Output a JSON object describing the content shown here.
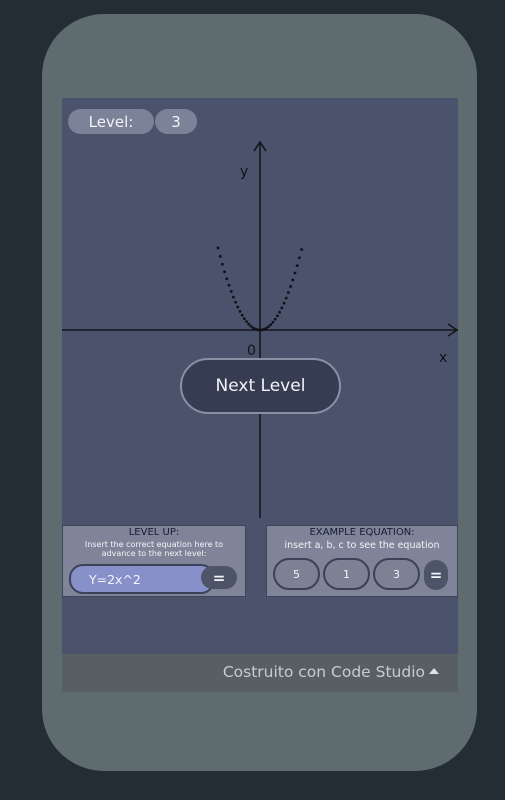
{
  "level": {
    "label": "Level:",
    "value": "3"
  },
  "graph": {
    "x_label": "x",
    "y_label": "y",
    "origin_label": "0",
    "curve_coefficient": 2
  },
  "next_level_button": {
    "label": "Next Level"
  },
  "level_up_panel": {
    "title": "LEVEL UP:",
    "description": "Insert the correct equation here to advance to the next level:",
    "equation_value": "Y=2x^2",
    "equals_label": "="
  },
  "example_panel": {
    "title": "EXAMPLE EQUATION:",
    "description": "insert a, b, c to see the equation",
    "a": "5",
    "b": "1",
    "c": "3",
    "equals_label": "="
  },
  "footer": {
    "text": "Costruito con Code Studio"
  },
  "colors": {
    "background": "#242c35",
    "device": "#5e6b6f",
    "screen": "#4b526b",
    "input_fill": "#8790c8"
  }
}
